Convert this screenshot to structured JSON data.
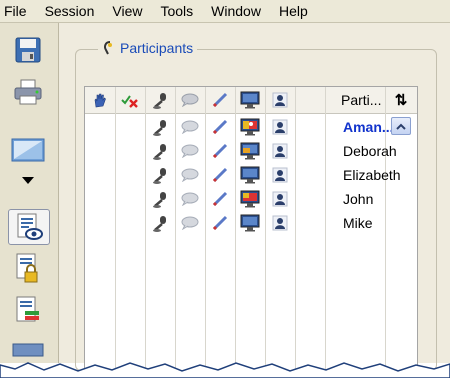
{
  "menu": [
    "File",
    "Session",
    "View",
    "Tools",
    "Window",
    "Help"
  ],
  "toolbar": {
    "items": [
      "save-icon",
      "print-icon",
      "whiteboard-icon",
      "dropdown-arrow-icon",
      "participants-view-icon",
      "locked-document-icon",
      "status-list-icon",
      "screen-icon"
    ]
  },
  "panel": {
    "title": "Participants",
    "columns": {
      "raise_hand": "hand-icon",
      "permissions": "revoke-icon",
      "audio": "microphone-icon",
      "chat": "chat-bubble-icon",
      "annotate": "pen-icon",
      "video": "monitor-icon",
      "user": "user-icon",
      "name": "Parti...",
      "sort": "⇅"
    },
    "participants": [
      {
        "name": "Aman...",
        "selected": true,
        "video": "presenter"
      },
      {
        "name": "Deborah",
        "selected": false,
        "video": "colored"
      },
      {
        "name": "Elizabeth",
        "selected": false,
        "video": "normal"
      },
      {
        "name": "John",
        "selected": false,
        "video": "red"
      },
      {
        "name": "Mike",
        "selected": false,
        "video": "normal"
      }
    ]
  },
  "colors": {
    "accent": "#1a4bb8",
    "selected_name": "#1133cc",
    "chrome": "#ece9d8",
    "panel": "#efebde"
  }
}
